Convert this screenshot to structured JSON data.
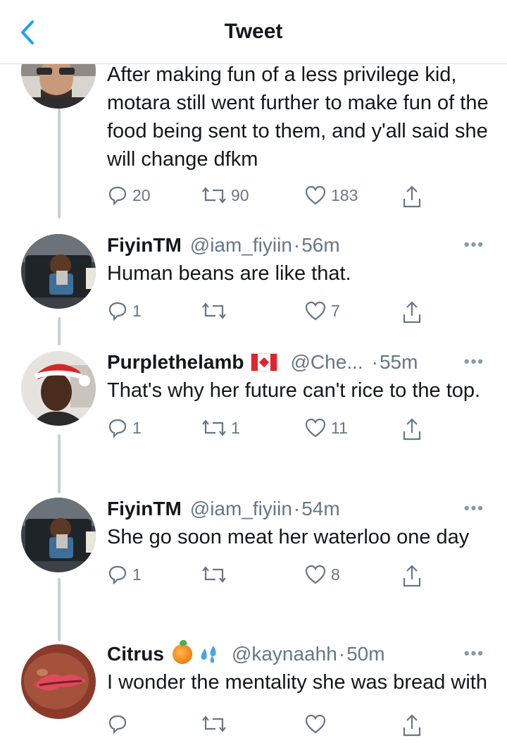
{
  "header": {
    "title": "Tweet"
  },
  "colors": {
    "accent": "#1da1f2",
    "text": "#14171a",
    "muted": "#657786"
  },
  "tweets": [
    {
      "avatar": "profile-photo-man-glasses",
      "text": "After making fun of a less privilege kid, motara still went further to make fun of the food being sent to them, and y'all said she will change dfkm",
      "replies": "20",
      "retweets": "90",
      "likes": "183"
    },
    {
      "name": "FiyinTM",
      "handle": "@iam_fiyiin",
      "time": "56m",
      "avatar": "profile-photo-man-car",
      "text": "Human beans are like that.",
      "replies": "1",
      "retweets": "",
      "likes": "7"
    },
    {
      "name": "Purplethelamb",
      "flag": "canada-flag",
      "handle": "@Che...",
      "time": "55m",
      "avatar": "profile-photo-santa-hat",
      "text": "That's why her future can't rice to the top.",
      "replies": "1",
      "retweets": "1",
      "likes": "11"
    },
    {
      "name": "FiyinTM",
      "handle": "@iam_fiyiin",
      "time": "54m",
      "avatar": "profile-photo-man-car",
      "text": "She go soon meat her waterloo one day",
      "replies": "1",
      "retweets": "",
      "likes": "8"
    },
    {
      "name": "Citrus",
      "emojis": [
        "orange-emoji",
        "sweat-droplets-emoji"
      ],
      "handle": "@kaynaahh",
      "time": "50m",
      "avatar": "profile-photo-lips",
      "text": "I wonder the mentality she was bread with"
    }
  ]
}
